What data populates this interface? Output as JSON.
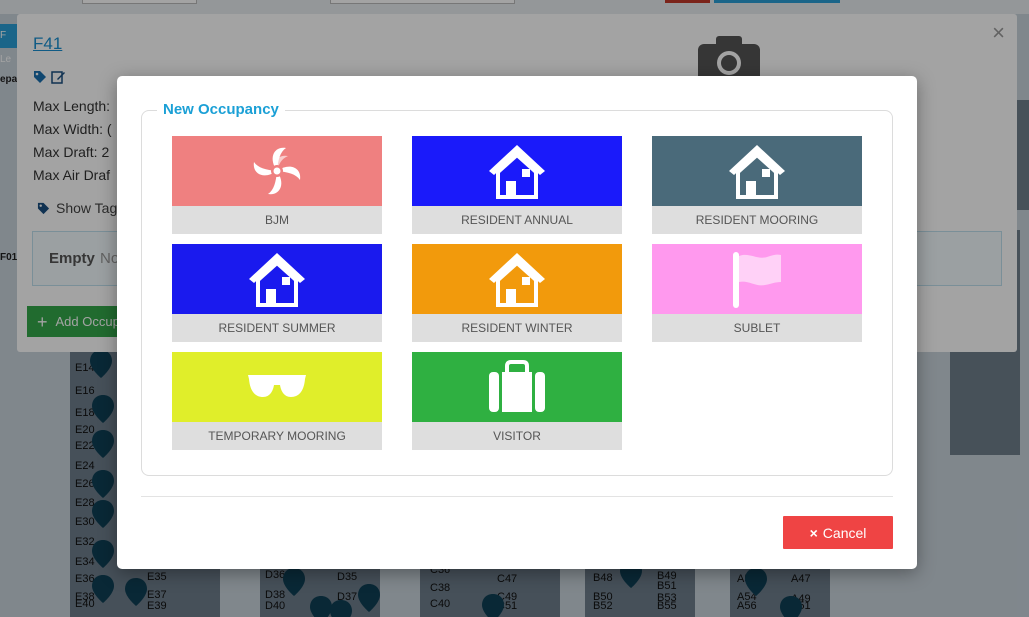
{
  "background": {
    "strip_label": "F Le",
    "side_label_top": "epa",
    "side_label_mid": "F01",
    "berths": [
      "E14",
      "E16",
      "E18",
      "E20",
      "E22",
      "E24",
      "E26",
      "E28",
      "E30",
      "E32",
      "E34",
      "E36",
      "E38",
      "E40",
      "E35",
      "E37",
      "E39",
      "D36",
      "D38",
      "D40",
      "D35",
      "D37",
      "C36",
      "C38",
      "C40",
      "C47",
      "C49",
      "C51",
      "B48",
      "B50",
      "B52",
      "B49",
      "B51",
      "B53",
      "B55",
      "A52",
      "A54",
      "A56",
      "A47",
      "A49",
      "A51"
    ]
  },
  "panel": {
    "title": "F41",
    "max_length": "Max Length:",
    "max_width": "Max Width: (",
    "max_draft": "Max Draft: 2",
    "max_air_draft": "Max Air Draf",
    "show_tags": "Show Tag",
    "empty_label": "Empty",
    "empty_rest": "No",
    "add_button": "Add Occup",
    "close": "×"
  },
  "modal": {
    "legend": "New Occupancy",
    "cancel_label": "Cancel",
    "cancel_icon": "×",
    "tiles": [
      {
        "label": "BJM",
        "color": "#ef8080",
        "icon": "fan-icon"
      },
      {
        "label": "RESIDENT ANNUAL",
        "color": "#1a1afa",
        "icon": "house-icon"
      },
      {
        "label": "RESIDENT MOORING",
        "color": "#4a6a7a",
        "icon": "house-icon"
      },
      {
        "label": "RESIDENT SUMMER",
        "color": "#1a1aee",
        "icon": "house-icon"
      },
      {
        "label": "RESIDENT WINTER",
        "color": "#f29a0c",
        "icon": "house-icon"
      },
      {
        "label": "SUBLET",
        "color": "#ff99ee",
        "icon": "flag-icon"
      },
      {
        "label": "TEMPORARY MOORING",
        "color": "#e0ee2a",
        "icon": "sunglasses-icon"
      },
      {
        "label": "VISITOR",
        "color": "#2fb041",
        "icon": "suitcase-icon"
      }
    ]
  }
}
